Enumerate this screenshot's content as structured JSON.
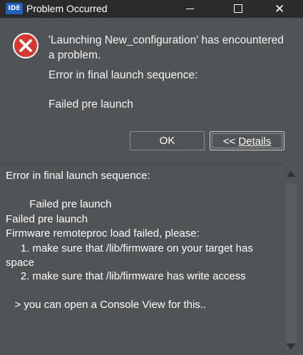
{
  "window": {
    "app_icon_text": "IDE",
    "title": "Problem Occurred",
    "controls": [
      "minimize-icon",
      "maximize-icon",
      "close-icon"
    ]
  },
  "dialog": {
    "icon": "error-icon",
    "message_line1": "'Launching New_configuration' has encountered",
    "message_line2": "a problem.",
    "sub_message": "Error in final launch sequence:",
    "reason": "Failed pre launch"
  },
  "buttons": {
    "ok_label": "OK",
    "details_prefix": "<< ",
    "details_label": "Details"
  },
  "details": {
    "lines": [
      "Error in final launch sequence:",
      "",
      "        Failed pre launch",
      "Failed pre launch",
      "Firmware remoteproc load failed, please:",
      "     1. make sure that /lib/firmware on your target has",
      "space",
      "     2. make sure that /lib/firmware has write access",
      "",
      "   > you can open a Console View for this.."
    ]
  },
  "colors": {
    "background": "#505456",
    "titlebar": "#2b2b2b",
    "error_red": "#d9372e",
    "text": "#ffffff"
  }
}
